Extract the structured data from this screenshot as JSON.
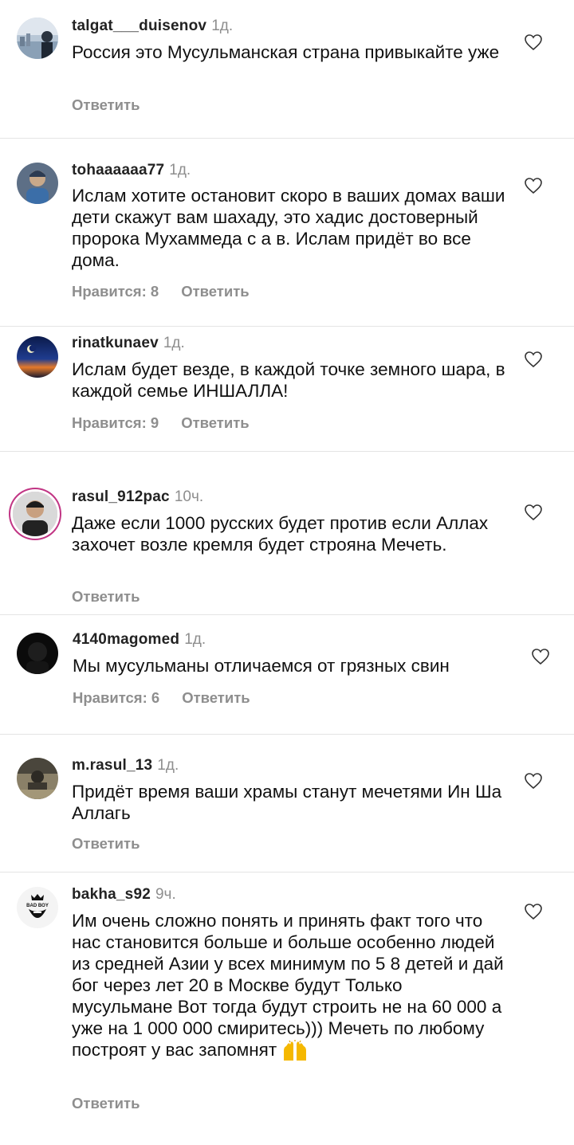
{
  "comments": [
    {
      "username": "talgat___duisenov",
      "time": "1д.",
      "text": "Россия это Мусульманская страна привыкайте уже",
      "likes": "",
      "reply": "Ответить"
    },
    {
      "username": "tohaaaaaa77",
      "time": "1д.",
      "text": "Ислам хотите остановит скоро в ваших домах ваши дети скажут вам шахаду, это хадис достоверный пророка Мухаммеда с а в. Ислам придёт во все дома.",
      "likes": "Нравится: 8",
      "reply": "Ответить"
    },
    {
      "username": "rinatkunaev",
      "time": "1д.",
      "text": "Ислам будет везде, в каждой точке земного шара, в каждой семье ИНШАЛЛА!",
      "likes": "Нравится: 9",
      "reply": "Ответить"
    },
    {
      "username": "rasul_912pac",
      "time": "10ч.",
      "text": "Даже если 1000 русских будет против если Аллах захочет возле кремля будет строяна Мечеть.",
      "likes": "",
      "reply": "Ответить"
    },
    {
      "username": "4140magomed",
      "time": "1д.",
      "text": "Мы мусульманы отличаемся от грязных свин",
      "likes": "Нравится: 6",
      "reply": "Ответить"
    },
    {
      "username": "m.rasul_13",
      "time": "1д.",
      "text": "Придёт время ваши храмы станут мечетями Ин Ша Аллагь",
      "likes": "",
      "reply": "Ответить"
    },
    {
      "username": "bakha_s92",
      "time": "9ч.",
      "text": "Им очень сложно понять и принять факт того что нас становится больше и больше особенно людей из средней Азии у всех минимум по 5 8 детей и дай бог через лет 20 в Москве будут Только мусульмане Вот тогда будут строить не на 60 000 а уже на 1 000 000 смиритесь))) Мечеть по любому построят у вас запомнят",
      "likes": "",
      "reply": "Ответить",
      "avatar_text": "BAD BOY"
    }
  ],
  "icons": {
    "like": "heart-outline-icon",
    "emoji": "raising-hands-emoji"
  },
  "colors": {
    "muted": "#8e8e8e",
    "story_ring": "#c13584",
    "emoji": "#f5b800"
  }
}
